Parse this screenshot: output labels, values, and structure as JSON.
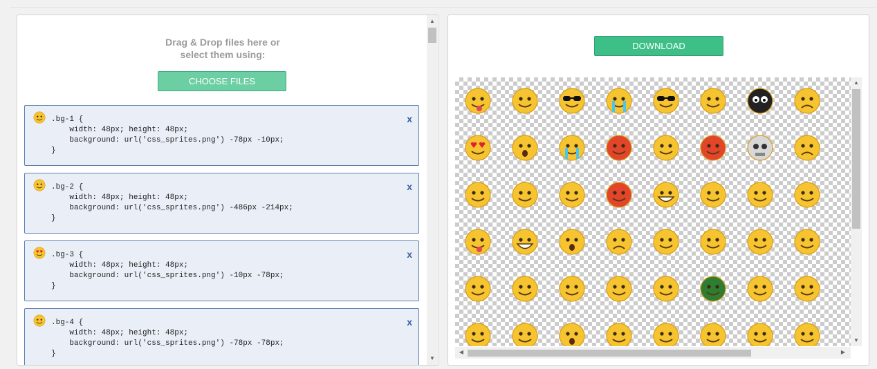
{
  "left": {
    "drop_text_line1": "Drag & Drop files here or",
    "drop_text_line2": "select them using:",
    "choose_label": "CHOOSE FILES",
    "cards": [
      {
        "code": ".bg-1 {\n    width: 48px; height: 48px;\n    background: url('css_sprites.png') -78px -10px;\n}",
        "close": "x",
        "icon": "smile-emoji-icon"
      },
      {
        "code": ".bg-2 {\n    width: 48px; height: 48px;\n    background: url('css_sprites.png') -486px -214px;\n}",
        "close": "x",
        "icon": "confused-emoji-icon"
      },
      {
        "code": ".bg-3 {\n    width: 48px; height: 48px;\n    background: url('css_sprites.png') -10px -78px;\n}",
        "close": "x",
        "icon": "heart-eyes-emoji-icon"
      },
      {
        "code": ".bg-4 {\n    width: 48px; height: 48px;\n    background: url('css_sprites.png') -78px -78px;\n}",
        "close": "x",
        "icon": "dizzy-emoji-icon"
      }
    ]
  },
  "right": {
    "download_label": "DOWNLOAD",
    "sprite_colors": {
      "face": "#f6c430",
      "face_edge": "#d99a10",
      "red": "#e2452a",
      "skull": "#d8d8d8",
      "dark": "#222222",
      "green": "#2e7d32"
    },
    "sprite_rows": [
      [
        "tongue-emoji-icon",
        "smile-emoji-icon",
        "sunglasses-emoji-icon",
        "crying-emoji-icon",
        "shades-angry-emoji-icon",
        "dazed-emoji-icon",
        "black-bug-emoji-icon",
        "worried-emoji-icon"
      ],
      [
        "heart-eyes-emoji-icon",
        "shocked-emoji-icon",
        "tears-stream-emoji-icon",
        "angry-red-emoji-icon",
        "blush-eyes-emoji-icon",
        "furious-emoji-icon",
        "skull-emoji-icon",
        "sad-emoji-icon"
      ],
      [
        "blush-smile-emoji-icon",
        "zipped-emoji-icon",
        "sleepy-emoji-icon",
        "red-rage-emoji-icon",
        "laugh-cry-emoji-icon",
        "sweat-emoji-icon",
        "hammer-emoji-icon",
        "smirk-emoji-icon"
      ],
      [
        "wink-tongue-emoji-icon",
        "grin-emoji-icon",
        "surprised-emoji-icon",
        "frown-emoji-icon",
        "drool-emoji-icon",
        "happy-emoji-icon",
        "thinking-emoji-icon",
        "nervous-emoji-icon"
      ],
      [
        "cover-mouth-emoji-icon",
        "shy-emoji-icon",
        "rolling-eyes-emoji-icon",
        "puzzled-emoji-icon",
        "skeptical-emoji-icon",
        "turtle-emoji-icon",
        "unamused-emoji-icon",
        "annoyed-emoji-icon"
      ],
      [
        "headband-emoji-icon",
        "naughty-emoji-icon",
        "question-emoji-icon",
        "pray-emoji-icon",
        "dizzy-emoji-icon",
        "squint-emoji-icon",
        "kiss-emoji-icon",
        "starry-emoji-icon"
      ]
    ]
  }
}
